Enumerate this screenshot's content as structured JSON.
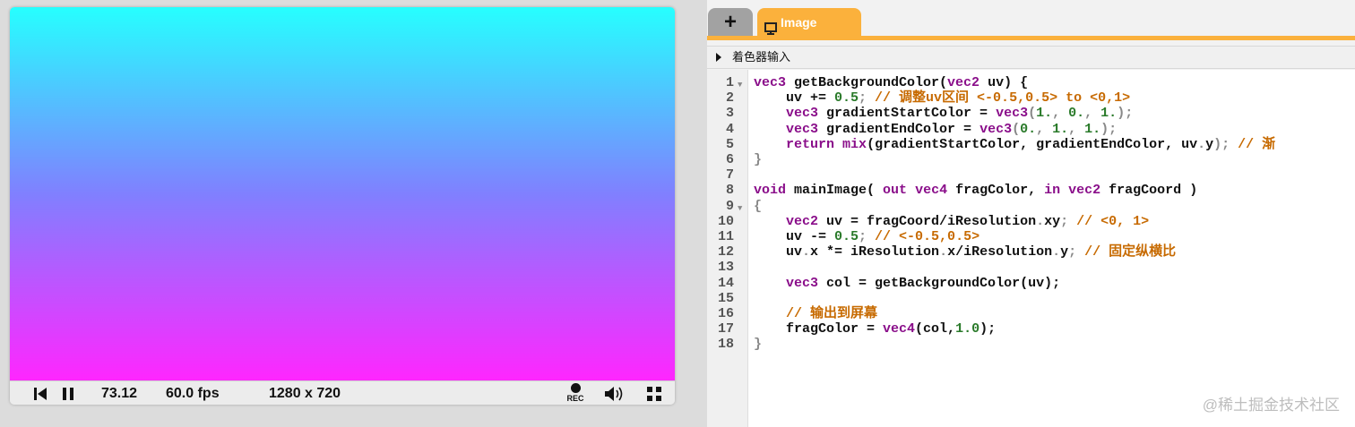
{
  "player": {
    "time": "73.12",
    "fps": "60.0 fps",
    "resolution": "1280 x 720",
    "rec_label": "REC",
    "gradient_colors": [
      "#26ffff",
      "#8080ff",
      "#ff26ff"
    ]
  },
  "tabs": {
    "add": "+",
    "image": "Image"
  },
  "accent_color": "#fbb13c",
  "section": {
    "label": "着色器输入"
  },
  "code": {
    "line_numbers": [
      "1",
      "2",
      "3",
      "4",
      "5",
      "6",
      "7",
      "8",
      "9",
      "10",
      "11",
      "12",
      "13",
      "14",
      "15",
      "16",
      "17",
      "18"
    ],
    "l1": [
      "vec3",
      " getBackgroundColor(",
      "vec2",
      " uv) {"
    ],
    "l2": [
      "    uv += ",
      "0.5",
      ";",
      " // 调整uv区间 <-0.5,0.5> to <0,1>"
    ],
    "l3": [
      "    ",
      "vec3",
      " gradientStartColor = ",
      "vec3",
      "(",
      "1.",
      ", ",
      "0.",
      ", ",
      "1.",
      ");"
    ],
    "l4": [
      "    ",
      "vec3",
      " gradientEndColor = ",
      "vec3",
      "(",
      "0.",
      ", ",
      "1.",
      ", ",
      "1.",
      ");"
    ],
    "l5": [
      "    ",
      "return",
      " ",
      "mix",
      "(gradientStartColor, gradientEndColor, uv",
      ".",
      "y",
      ");",
      " // 渐"
    ],
    "l6": [
      "}"
    ],
    "l8": [
      "void",
      " mainImage( ",
      "out",
      " ",
      "vec4",
      " fragColor, ",
      "in",
      " ",
      "vec2",
      " fragCoord )"
    ],
    "l9": [
      "{"
    ],
    "l10": [
      "    ",
      "vec2",
      " uv = fragCoord/iResolution",
      ".",
      "xy",
      ";",
      " // <0, 1>"
    ],
    "l11": [
      "    uv -= ",
      "0.5",
      ";",
      " // <-0.5,0.5>"
    ],
    "l12": [
      "    uv",
      ".",
      "x *= iResolution",
      ".",
      "x/iResolution",
      ".",
      "y",
      ";",
      " // 固定纵横比"
    ],
    "l14": [
      "    ",
      "vec3",
      " col = getBackgroundColor(uv);"
    ],
    "l16": [
      "    // 输出到屏幕"
    ],
    "l17": [
      "    fragColor = ",
      "vec4",
      "(col,",
      "1.0",
      ");"
    ],
    "l18": [
      "}"
    ]
  },
  "watermark": "@稀土掘金技术社区"
}
